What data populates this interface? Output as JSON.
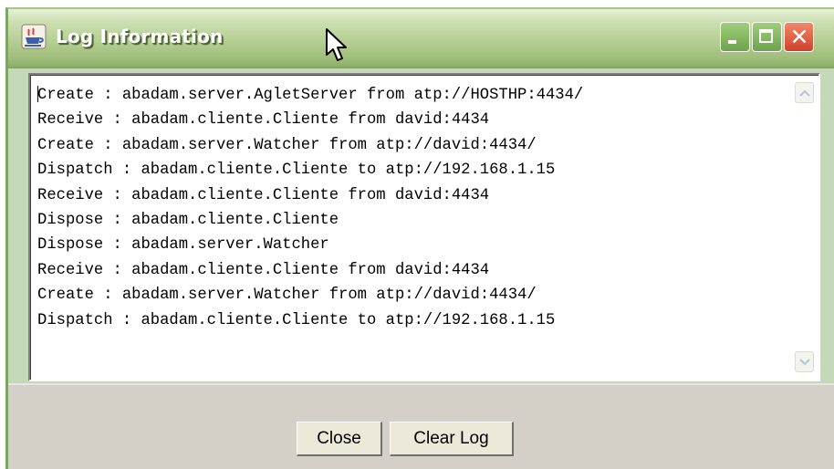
{
  "window": {
    "title": "Log Information",
    "icon": "java-cup-icon",
    "controls": {
      "minimize": "minimize-icon",
      "maximize": "maximize-icon",
      "close": "close-icon"
    }
  },
  "log": {
    "lines": [
      "Create : abadam.server.AgletServer from atp://HOSTHP:4434/",
      "Receive : abadam.cliente.Cliente from david:4434",
      "Create : abadam.server.Watcher from atp://david:4434/",
      "Dispatch : abadam.cliente.Cliente to atp://192.168.1.15",
      "Receive : abadam.cliente.Cliente from david:4434",
      "Dispose : abadam.cliente.Cliente",
      "Dispose : abadam.server.Watcher",
      "Receive : abadam.cliente.Cliente from david:4434",
      "Create : abadam.server.Watcher from atp://david:4434/",
      "Dispatch : abadam.cliente.Cliente to atp://192.168.1.15"
    ]
  },
  "buttons": {
    "close_label": "Close",
    "clear_label": "Clear Log"
  },
  "colors": {
    "titlebar": "#9fbd7a",
    "title_text": "#ffffff",
    "close_button": "#d1402a",
    "panel": "#d4d0c8"
  }
}
